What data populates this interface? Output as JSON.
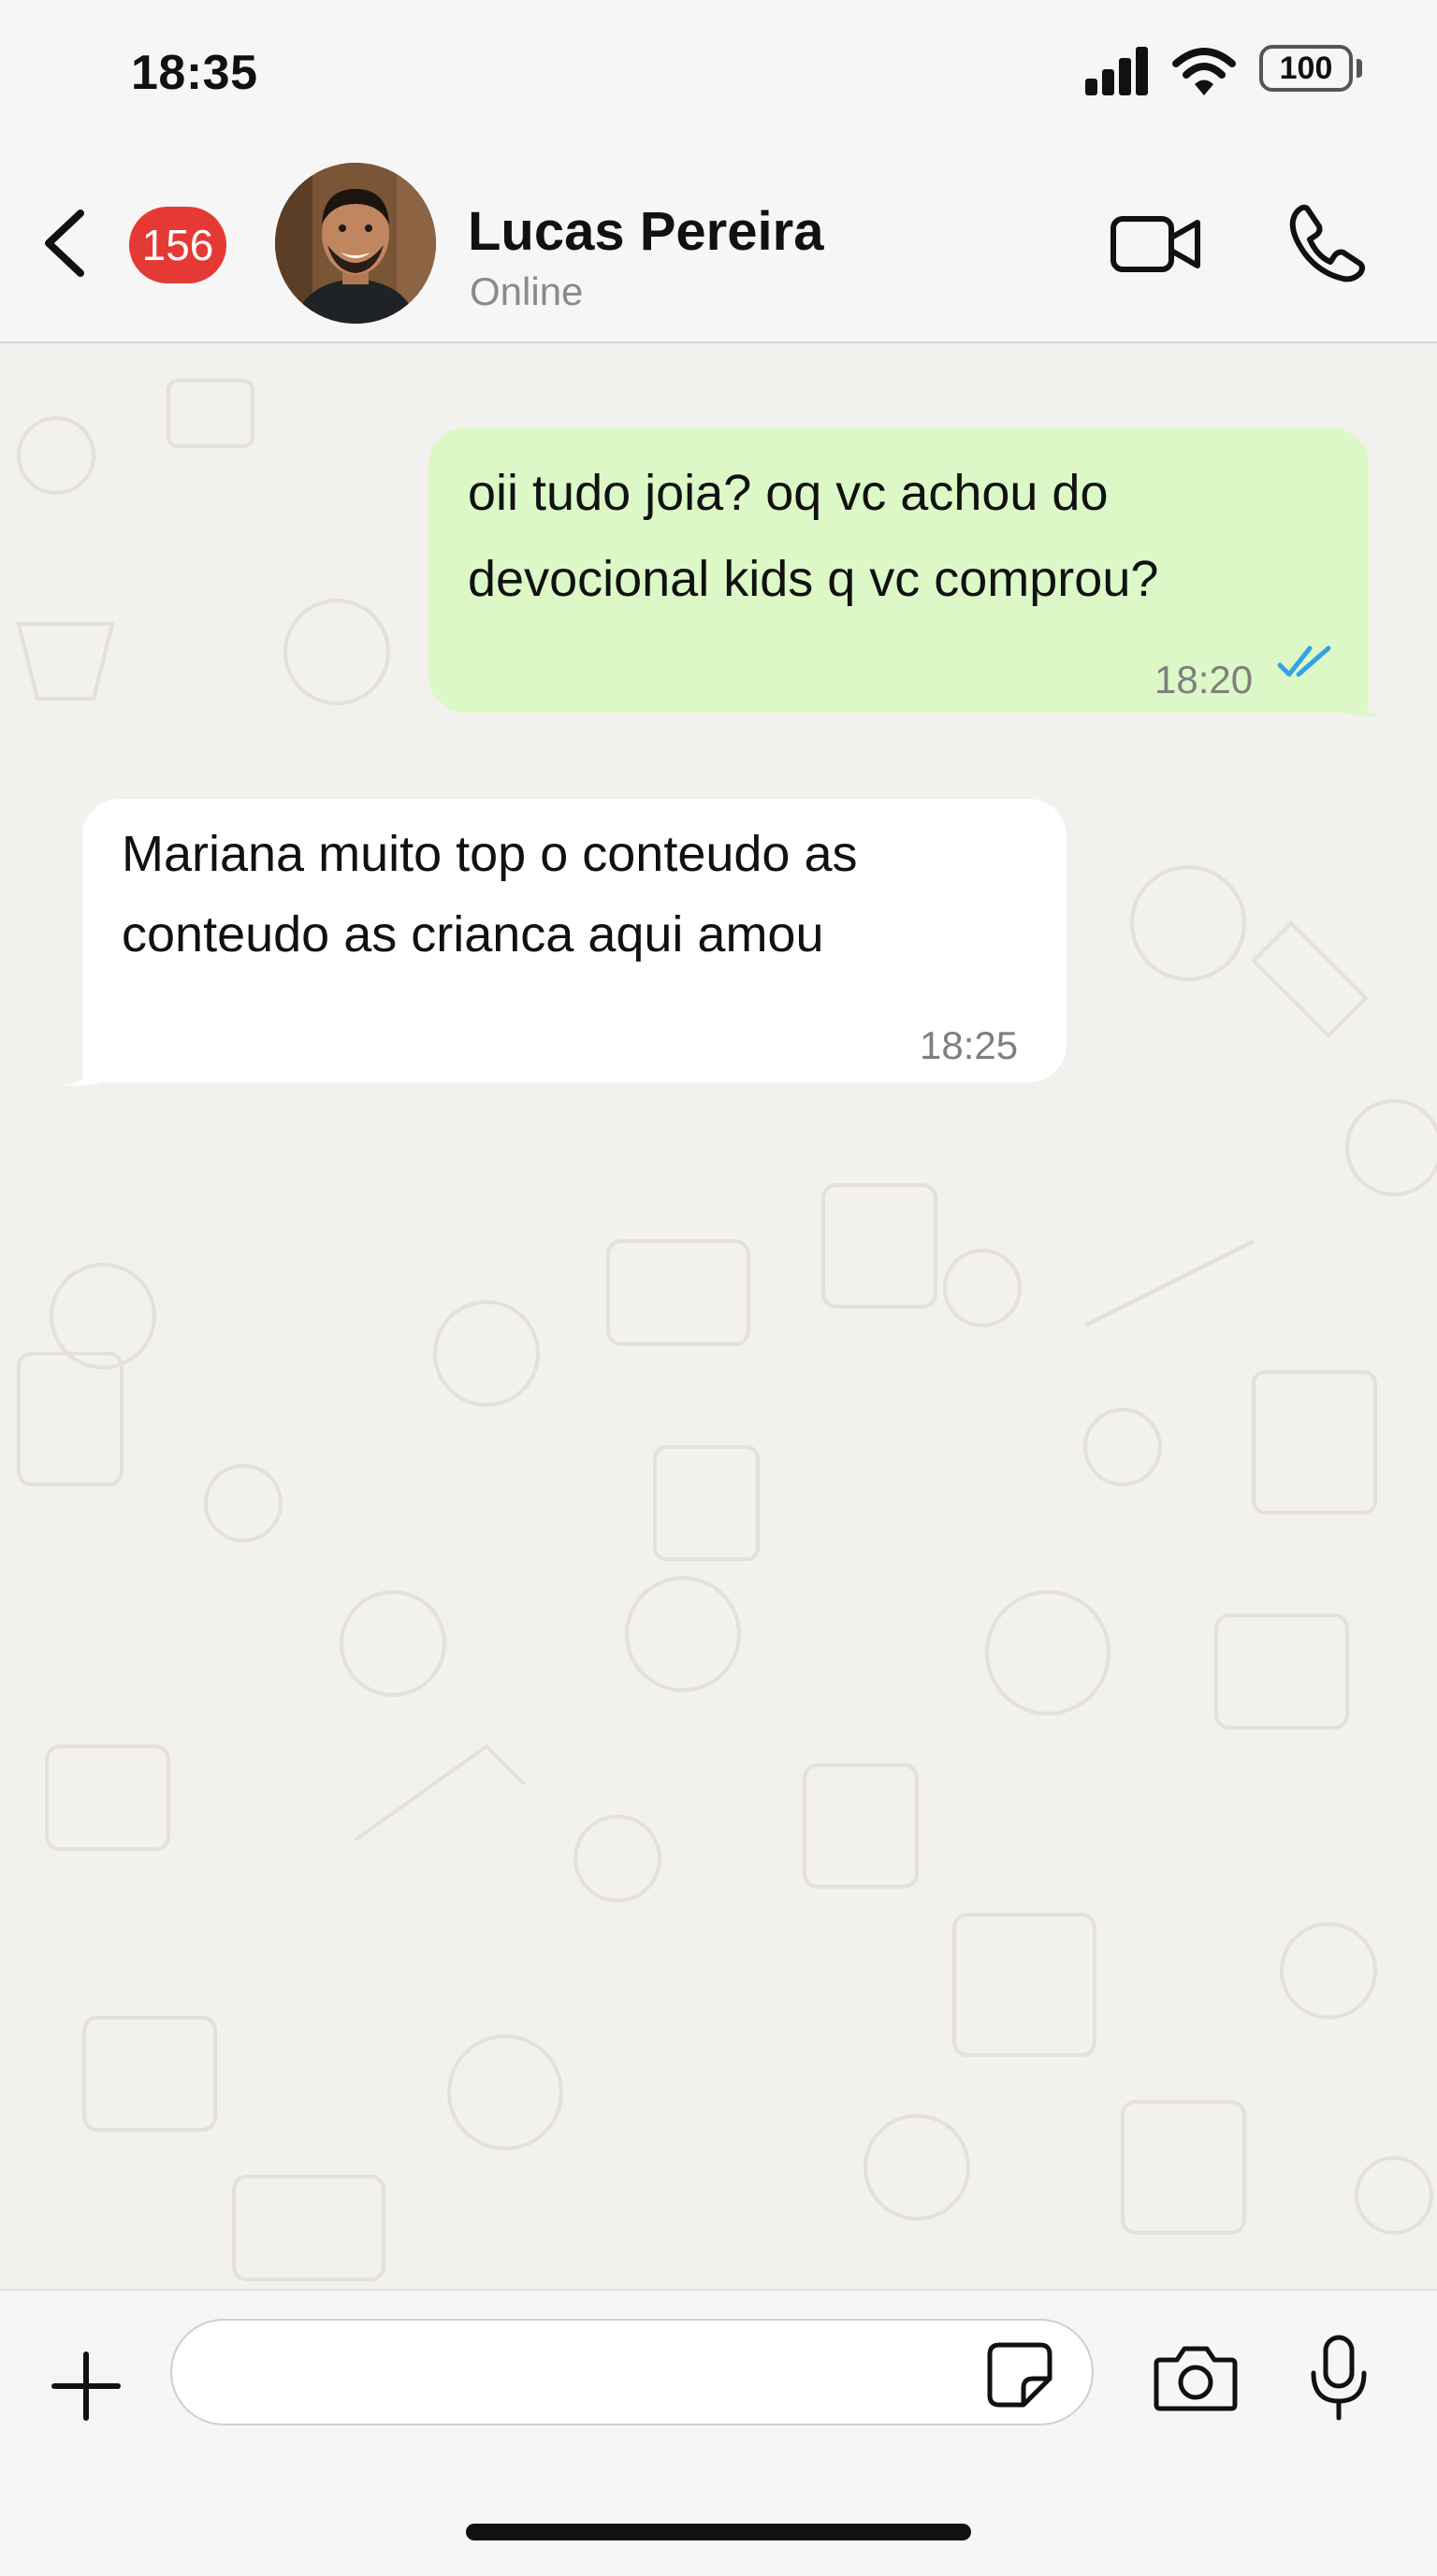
{
  "status_bar": {
    "time": "18:35",
    "battery": "100",
    "icons": [
      "signal-icon",
      "wifi-icon",
      "battery-icon"
    ]
  },
  "header": {
    "unread_count": "156",
    "contact_name": "Lucas Pereira",
    "contact_status": "Online",
    "icons": [
      "back-icon",
      "video-call-icon",
      "voice-call-icon"
    ]
  },
  "messages": [
    {
      "direction": "outgoing",
      "text": "oii tudo joia? oq vc achou do devocional kids q vc comprou?",
      "time": "18:20",
      "status": "read"
    },
    {
      "direction": "incoming",
      "text": "Mariana muito top o conteudo as conteudo as crianca aqui amou",
      "time": "18:25"
    }
  ],
  "input_bar": {
    "placeholder": "",
    "icons": [
      "plus-icon",
      "sticker-icon",
      "camera-icon",
      "microphone-icon"
    ]
  },
  "colors": {
    "outgoing_bubble": "#dcf8c6",
    "incoming_bubble": "#ffffff",
    "badge": "#e53935",
    "read_ticks": "#34a3e6",
    "chat_background": "#f3f1ee"
  }
}
